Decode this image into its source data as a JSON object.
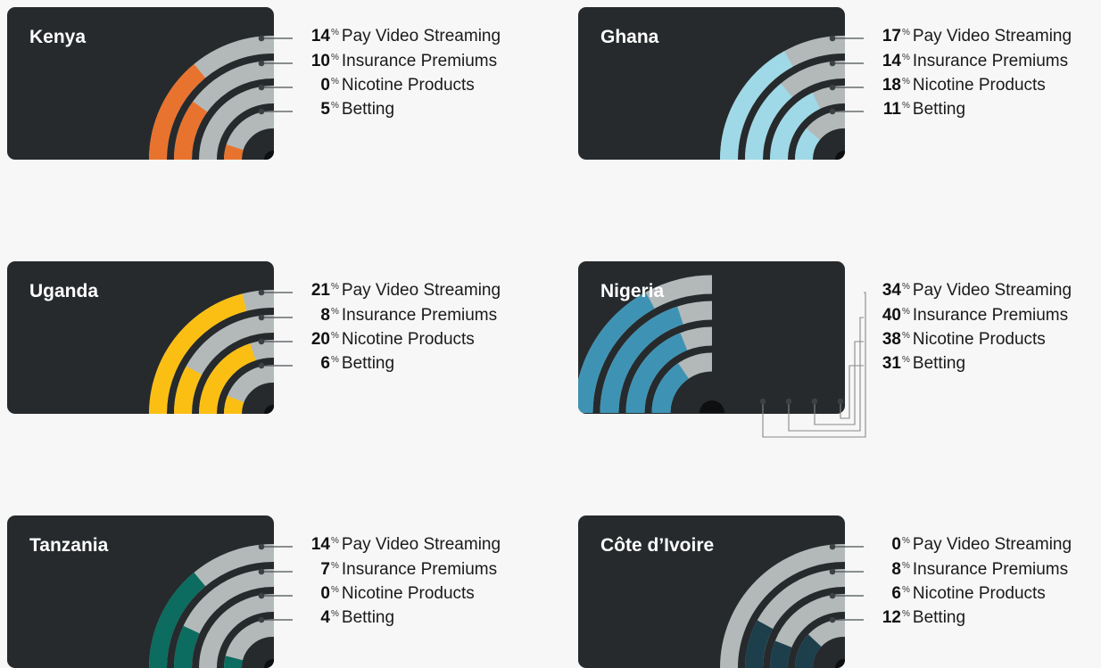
{
  "colors": {
    "track": "#b3b9b9",
    "card": "#262a2c",
    "connector": "#4a4f51",
    "dot": "#3c4143"
  },
  "category_labels": [
    "Pay Video Streaming",
    "Insurance Premiums",
    "Nicotine Products",
    "Betting"
  ],
  "percent_sign": "%",
  "chart_data": [
    {
      "type": "radial-bar",
      "country": "Kenya",
      "color": "#e8732e",
      "series": [
        {
          "name": "Pay Video Streaming",
          "value": 14
        },
        {
          "name": "Insurance Premiums",
          "value": 10
        },
        {
          "name": "Nicotine Products",
          "value": 0
        },
        {
          "name": "Betting",
          "value": 5
        }
      ]
    },
    {
      "type": "radial-bar",
      "country": "Ghana",
      "color": "#9fd8e6",
      "series": [
        {
          "name": "Pay Video Streaming",
          "value": 17
        },
        {
          "name": "Insurance Premiums",
          "value": 14
        },
        {
          "name": "Nicotine Products",
          "value": 18
        },
        {
          "name": "Betting",
          "value": 11
        }
      ]
    },
    {
      "type": "radial-bar",
      "country": "Uganda",
      "color": "#fbbf14",
      "series": [
        {
          "name": "Pay Video Streaming",
          "value": 21
        },
        {
          "name": "Insurance Premiums",
          "value": 8
        },
        {
          "name": "Nicotine Products",
          "value": 20
        },
        {
          "name": "Betting",
          "value": 6
        }
      ]
    },
    {
      "type": "radial-bar",
      "country": "Nigeria",
      "color": "#3e93b4",
      "series": [
        {
          "name": "Pay Video Streaming",
          "value": 34
        },
        {
          "name": "Insurance Premiums",
          "value": 40
        },
        {
          "name": "Nicotine Products",
          "value": 38
        },
        {
          "name": "Betting",
          "value": 31
        }
      ]
    },
    {
      "type": "radial-bar",
      "country": "Tanzania",
      "color": "#0b6c5f",
      "series": [
        {
          "name": "Pay Video Streaming",
          "value": 14
        },
        {
          "name": "Insurance Premiums",
          "value": 7
        },
        {
          "name": "Nicotine Products",
          "value": 0
        },
        {
          "name": "Betting",
          "value": 4
        }
      ]
    },
    {
      "type": "radial-bar",
      "country": "Côte d’Ivoire",
      "color": "#1d3f4c",
      "series": [
        {
          "name": "Pay Video Streaming",
          "value": 0
        },
        {
          "name": "Insurance Premiums",
          "value": 8
        },
        {
          "name": "Nicotine Products",
          "value": 6
        },
        {
          "name": "Betting",
          "value": 12
        }
      ]
    }
  ]
}
